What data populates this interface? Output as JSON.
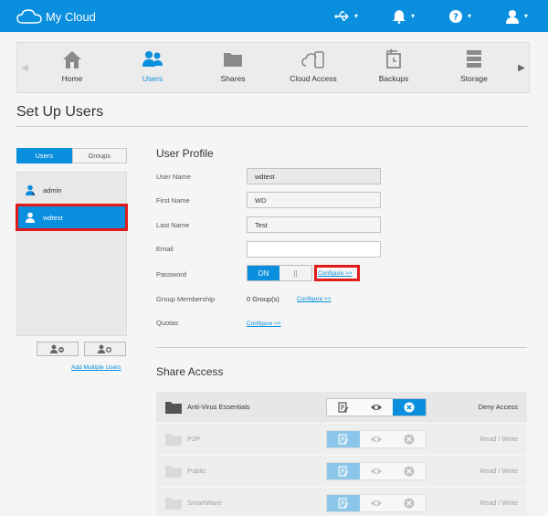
{
  "app": {
    "logo_text": "My Cloud"
  },
  "topbar": {
    "icons": [
      "usb-icon",
      "bell-icon",
      "help-icon",
      "user-icon"
    ]
  },
  "nav": {
    "items": [
      {
        "label": "Home",
        "icon": "home-icon"
      },
      {
        "label": "Users",
        "icon": "users-icon",
        "active": true
      },
      {
        "label": "Shares",
        "icon": "folder-icon"
      },
      {
        "label": "Cloud Access",
        "icon": "cloud-access-icon"
      },
      {
        "label": "Backups",
        "icon": "backup-icon"
      },
      {
        "label": "Storage",
        "icon": "storage-icon"
      }
    ]
  },
  "page": {
    "title": "Set Up Users"
  },
  "users_panel": {
    "tabs": [
      "Users",
      "Groups"
    ],
    "users": [
      "admin",
      "wdtest"
    ],
    "selected_user": "wdtest",
    "add_multiple_link": "Add Multiple Users"
  },
  "profile": {
    "title": "User Profile",
    "labels": {
      "user_name": "User Name",
      "first_name": "First Name",
      "last_name": "Last Name",
      "email": "Email",
      "password": "Password",
      "group_membership": "Group Membership",
      "quotas": "Quotas"
    },
    "values": {
      "user_name": "wdtest",
      "first_name": "WD",
      "last_name": "Test",
      "email": ""
    },
    "password_toggle": {
      "on": "ON",
      "off": "||"
    },
    "password_configure": "Configure >>",
    "group_count": "0 Group(s)",
    "group_configure": "Configure >>",
    "quotas_configure": "Configure >>"
  },
  "share_access": {
    "title": "Share Access",
    "shares": [
      {
        "name": "Anti-Virus Essentials",
        "access": "Deny Access",
        "dim": false
      },
      {
        "name": "P2P",
        "access": "Read / Write",
        "dim": true
      },
      {
        "name": "Public",
        "access": "Read / Write",
        "dim": true
      },
      {
        "name": "SmartWare",
        "access": "Read / Write",
        "dim": true
      }
    ]
  },
  "colors": {
    "accent": "#0a8fde",
    "highlight": "#e11919"
  }
}
